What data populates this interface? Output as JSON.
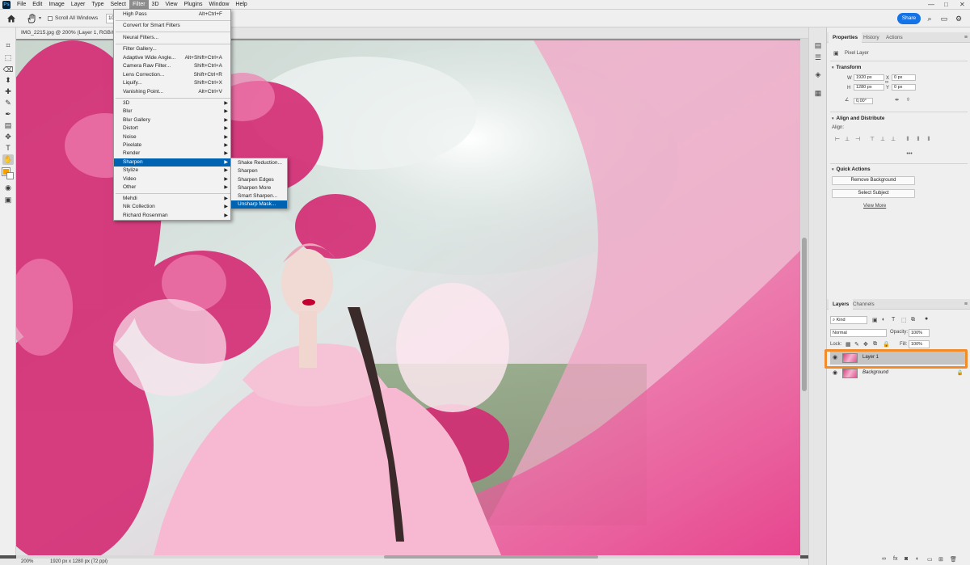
{
  "menubar": {
    "items": [
      "File",
      "Edit",
      "Image",
      "Layer",
      "Type",
      "Select",
      "Filter",
      "3D",
      "View",
      "Plugins",
      "Window",
      "Help"
    ],
    "active": "Filter",
    "window_controls": [
      "—",
      "□",
      "✕"
    ]
  },
  "optionsbar": {
    "scroll_all_label": "Scroll All Windows",
    "zoom_value": "100",
    "share_label": "Share"
  },
  "document": {
    "tab_title": "IMG_2215.jpg @ 200% (Layer 1, RGB/8#)",
    "zoom": "200%",
    "info": "1920 px x 1280 px (72 ppi)"
  },
  "filter_menu": {
    "top": [
      {
        "label": "High Pass",
        "shortcut": "Alt+Ctrl+F"
      },
      {
        "label": "Convert for Smart Filters",
        "shortcut": ""
      }
    ],
    "group2": [
      {
        "label": "Neural Filters...",
        "shortcut": ""
      }
    ],
    "group3": [
      {
        "label": "Filter Gallery...",
        "shortcut": ""
      },
      {
        "label": "Adaptive Wide Angle...",
        "shortcut": "Alt+Shift+Ctrl+A"
      },
      {
        "label": "Camera Raw Filter...",
        "shortcut": "Shift+Ctrl+A"
      },
      {
        "label": "Lens Correction...",
        "shortcut": "Shift+Ctrl+R"
      },
      {
        "label": "Liquify...",
        "shortcut": "Shift+Ctrl+X"
      },
      {
        "label": "Vanishing Point...",
        "shortcut": "Alt+Ctrl+V"
      }
    ],
    "group4": [
      "3D",
      "Blur",
      "Blur Gallery",
      "Distort",
      "Noise",
      "Pixelate",
      "Render",
      "Sharpen",
      "Stylize",
      "Video",
      "Other"
    ],
    "group5": [
      "Mehdi",
      "Nik Collection",
      "Richard Rosenman"
    ],
    "highlighted": "Sharpen"
  },
  "sharpen_submenu": {
    "items": [
      "Shake Reduction...",
      "Sharpen",
      "Sharpen Edges",
      "Sharpen More",
      "Smart Sharpen...",
      "Unsharp Mask..."
    ],
    "highlighted": "Unsharp Mask..."
  },
  "properties_panel": {
    "tabs": [
      "Properties",
      "History",
      "Actions"
    ],
    "layer_type": "Pixel Layer",
    "transform_title": "Transform",
    "w_label": "W",
    "w_value": "1920 px",
    "h_label": "H",
    "h_value": "1280 px",
    "x_label": "X",
    "x_value": "0 px",
    "y_label": "Y",
    "y_value": "0 px",
    "angle_value": "0,00°",
    "align_title": "Align and Distribute",
    "align_label": "Align:",
    "quick_actions_title": "Quick Actions",
    "remove_bg_label": "Remove Background",
    "select_subject_label": "Select Subject",
    "view_more_label": "View More"
  },
  "layers_panel": {
    "tabs": [
      "Layers",
      "Channels"
    ],
    "filter_kind": "Kind",
    "blend_mode": "Normal",
    "opacity_label": "Opacity:",
    "opacity_value": "100%",
    "lock_label": "Lock:",
    "fill_label": "Fill:",
    "fill_value": "100%",
    "layers": [
      {
        "name": "Layer 1",
        "selected": true
      },
      {
        "name": "Background",
        "selected": false
      }
    ]
  },
  "colors": {
    "accent": "#1473e6",
    "menu_highlight": "#0063b1",
    "foreground_swatch": "#f5a000",
    "callout": "#f28c2a"
  },
  "icons": [
    "home-icon",
    "hand-icon",
    "search-icon",
    "workspace-icon",
    "eye-icon",
    "lock-icon",
    "panel-menu-icon"
  ]
}
